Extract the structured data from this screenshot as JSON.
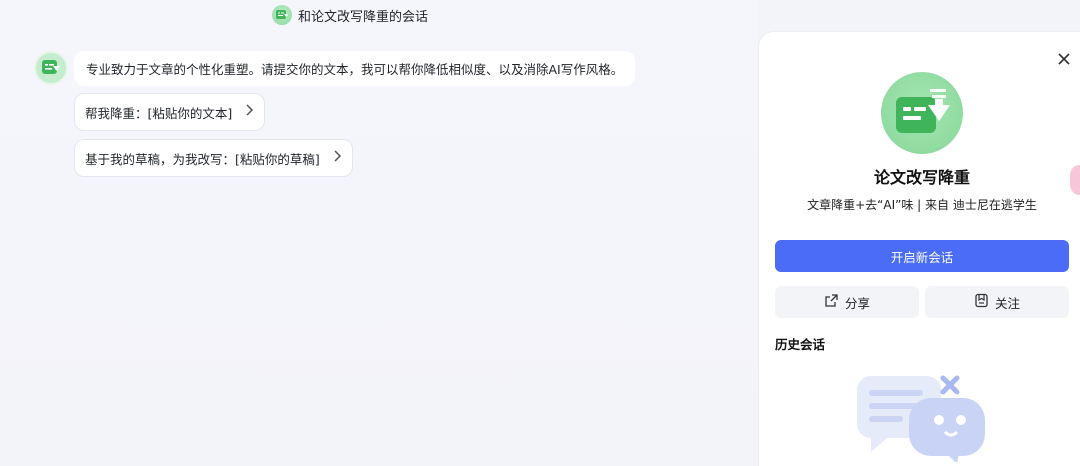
{
  "chat": {
    "title": "和论文改写降重的会话",
    "intro_message": "专业致力于文章的个性化重塑。请提交你的文本，我可以帮你降低相似度、以及消除AI写作风格。",
    "suggestions": [
      {
        "label": "帮我降重：[粘贴你的文本]"
      },
      {
        "label": "基于我的草稿，为我改写：[粘贴你的草稿]"
      }
    ]
  },
  "panel": {
    "bot_name": "论文改写降重",
    "bot_description": "文章降重+去“AI”味 | 来自 迪士尼在逃学生",
    "new_chat_label": "开启新会话",
    "share_label": "分享",
    "follow_label": "关注",
    "history_title": "历史会话"
  },
  "colors": {
    "accent": "#4a6cf7",
    "bot_green": "#8fdba0"
  },
  "icons": {
    "close": "close-icon",
    "share": "share-icon",
    "follow": "bookmark-icon",
    "chevron": "chevron-right-icon"
  }
}
